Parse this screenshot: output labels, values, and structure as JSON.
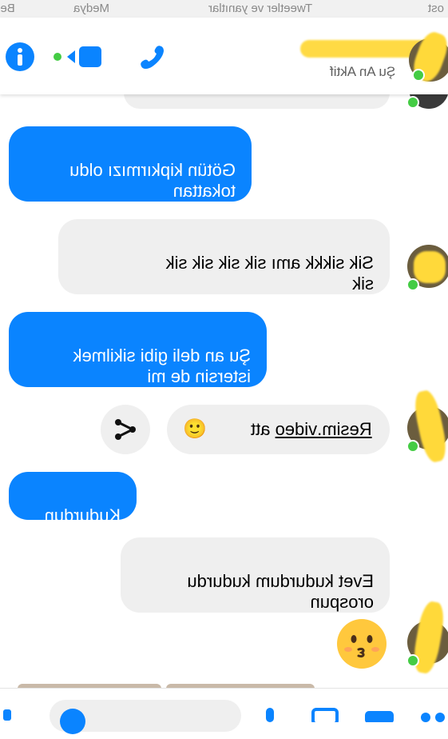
{
  "status_strip": {
    "left_text": "ost",
    "mid_text": "Tweetler ve yanıtlar",
    "right_text": "Medya",
    "far_right_text": "Beğ"
  },
  "header": {
    "contact_status": "Şu An Aktif",
    "icons": [
      "info-icon",
      "video-icon",
      "phone-icon"
    ]
  },
  "messages": [
    {
      "side": "blue",
      "text": "Götün kipkırmızı oldu\ntokattan"
    },
    {
      "side": "gray",
      "text": "Sik  sikkk   amı sik sik sik sik\nsik"
    },
    {
      "side": "blue",
      "text": "Şu an deli gibi sikilmek\nistersin de mi"
    },
    {
      "side": "gray-link",
      "text": "Resim.video",
      "suffix": " att ",
      "emoji": "🙂"
    },
    {
      "side": "blue",
      "text": "Kudurdun"
    },
    {
      "side": "gray",
      "text": "Evet kudurdum kudurdu\norospun"
    },
    {
      "side": "emoji",
      "emoji": "😗"
    }
  ],
  "colors": {
    "accent_blue": "#0a84ff",
    "bubble_gray": "#efefef",
    "online_green": "#44cc44",
    "redaction_yellow": "#ffd93a"
  }
}
